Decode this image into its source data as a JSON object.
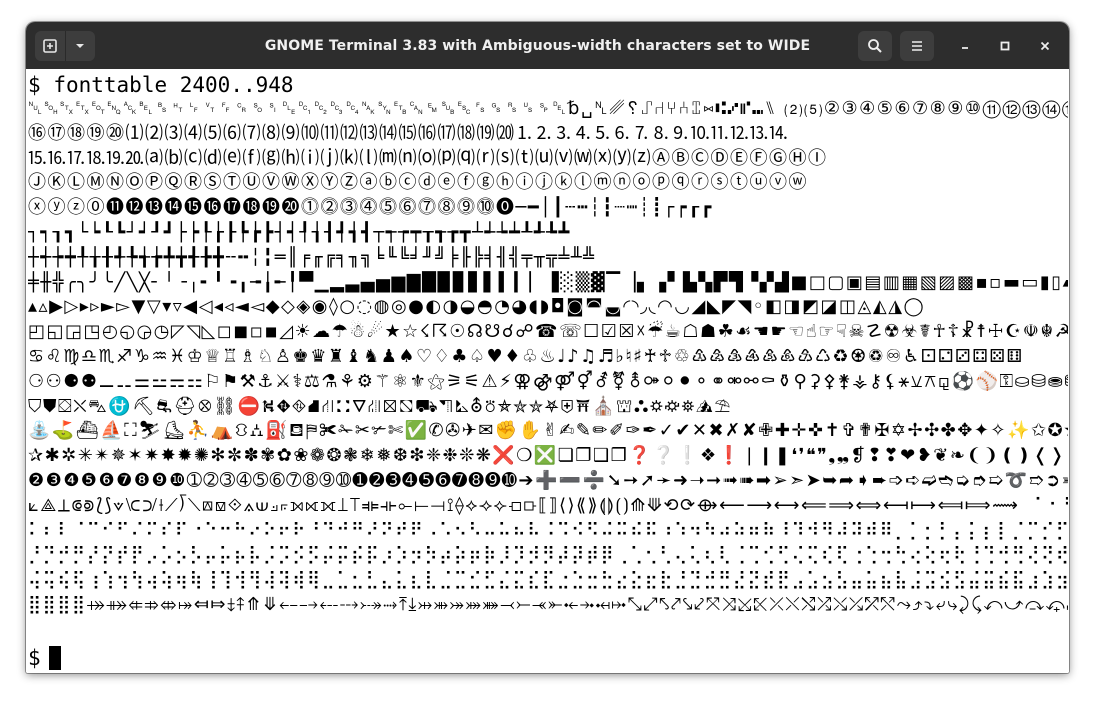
{
  "window": {
    "title": "GNOME Terminal 3.83 with Ambiguous-width characters set to WIDE"
  },
  "titlebar": {
    "new_tab_icon": "new-tab-icon",
    "menu_dropdown_icon": "chevron-down-icon",
    "search_icon": "search-icon",
    "hamburger_icon": "hamburger-menu-icon",
    "minimize_icon": "minimize-icon",
    "maximize_icon": "maximize-icon",
    "close_icon": "close-icon"
  },
  "terminal": {
    "prompt_symbol": "$",
    "command": "fonttable 2400..948",
    "rows": [
      "␀␁␂␃␄␅␆␇␈␉␊␋␌␍␎␏␐␑␒␓␔␕␖␗␘␙␚␛␜␝␞␟␠␡␢␣␤␥␦⑀⑁⑂⑃⑄⑅⑆⑇⑈⑉⑊ ⑵⑸②③④⑤⑥⑦⑧⑨⑩⑪⑫⑬⑭⑮",
      "⑯⑰⑱⑲⑳⑴⑵⑶⑷⑸⑹⑺⑻⑼⑽⑾⑿⒀⒁⒂⒃⒄⒅⒆⒇⒈⒉⒊⒋⒌⒍⒎⒏⒐⒑⒒⒓⒔⒕",
      "⒖⒗⒘⒙⒚⒛⒜⒝⒞⒟⒠⒡⒢⒣⒤⒥⒦⒧⒨⒩⒪⒫⒬⒭⒮⒯⒰⒱⒲⒳⒴⒵ⒶⒷⒸⒹⒺⒻⒼⒽⒾ",
      "ⒿⓀⓁⓂⓃⓄⓅⓆⓇⓈⓉⓊⓋⓌⓍⓎⓏⓐⓑⓒⓓⓔⓕⓖⓗⓘⓙⓚⓛⓜⓝⓞⓟⓠⓡⓢⓣⓤⓥⓦ",
      "ⓧⓨⓩ⓪⓫⓬⓭⓮⓯⓰⓱⓲⓳⓴⓵⓶⓷⓸⓹⓺⓻⓼⓽⓾⓿─━│┃┄┅┆┇┈┉┊┋┌┍┎┏",
      "┐┑┒┓└┕┖┗┘┙┚┛├┝┞┟┠┡┢┣┤┥┦┧┨┩┪┫┬┭┮┯┰┱┲┳┴┵┶┷┸┹┺┻",
      "┼┽┾┿╀╁╂╃╄╅╆╇╈╉╊╋╌╍╎╏═║╒╓╔╕╖╗╘╙╚╛╜╝╞╟╠╡╢╣╤╥╦╧╨╩",
      "╪╫╬╭╮╯╰╱╲╳╴╵╶╷╸╹╺╻╼╽╾╿▀▁▂▃▄▅▆▇█▉▊▋▌▍▎▏▐░▒▓▔▕▖▗▘▙▚▛▜▝▞▟■□▢▣▤▥▦▧▨▩▪▫▬▭▮▯▰▱▲△",
      "▴▵▶▷▸▹►▻▼▽▾▿◀◁◂◃◄◅◆◇◈◉◊○◌◍◎●◐◑◒◓◔◕◖◗◘◙◚◛◜◝◞◟◠◡◢◣◤◥◦◧◨◩◪◫◬◭◮◯",
      "◰◱◲◳◴◵◶◷◸◹◺◻◼◽◾◿☀☁☂☃☄★☆☇☈☉☊☋☌☍☎☏☐☑☒☓☔☕☖☗☘☙☚☛☜☝☞☟☠☡☢☣☤☥☦☧☨☩☪☫☬☭☮☯☰☱☲☳☴☵☶☷☸☹☺☻☼☽☾☿♀♁♂♃♄♅♆♇♈♉♊",
      "♋♌♍♎♏♐♑♒♓♔♕♖♗♘♙♚♛♜♝♞♟♠♡♢♣♤♥♦♧♨♩♪♫♬♭♮♯♰♱♲♳♴♵♶♷♸♹♺♻♼♽♾♿⚀⚁⚂⚃⚄⚅",
      "⚆⚇⚈⚉⚊⚋⚌⚍⚎⚏⚐⚑⚒⚓⚔⚕⚖⚗⚘⚙⚚⚛⚜⚝⚞⚟⚠⚡⚢⚣⚤⚥⚦⚧⚨⚩⚪⚫⚬⚭⚮⚯⚰⚱⚲⚳⚴⚵⚶⚷⚸⚹⚺⚻⚼⚽⚾⚿⛀⛁⛂⛃⛄⛅⛆⛇⛈",
      "⛉⛊⛋⛌⛍⛎⛏⛐⛑⛒⛓⛔⛕⛖⛗⛘⛙⛚⛛⛜⛝⛞⛟⛠⛡⛢⛣⛤⛥⛦⛧⛨⛩⛪⛫⛬⛭⛮⛯⛰⛱",
      "⛲⛳⛴⛵⛶⛷⛸⛹⛺⛻⛼⛽⛾⛿✀✁✂✃✄✅✆✇✈✉✊✋✌✍✎✏✐✑✒✓✔✕✖✗✘✙✚✛✜✝✞✟✠✡✢✣✤✥✦✧✨✩✪✫✬✭✮✯",
      "✰✱✲✳✴✵✶✷✸✹✺✻✼✽✾✿❀❁❂❃❄❅❆❇❈❉❊❋❌❍❎❏❐❑❒❓❔❕❖❗❘❙❚❛❜❝❞❟❠❡❢❣❤❥❦❧❨❩❪❫❬❭❮❯❰❱❲❳❴❵❶",
      "❷❸❹❺❻❼❽❾❿➀➁➂➃➄➅➆➇➈➉➊➋➌➍➎➏➐➑➒➓➔➕➖➗➘➙➚➛➜➝➞➟➠➡➢➣➤➥➦➧➨➩➪➫➬➭➮➯➰➱➲➳➴➵➶➷➸➹➺➻➼➽➾➿",
      "⟀⟁⟂⟃⟄⟅⟆⟇⟈⟉⟊⟋⟌⟍⟎⟏⟐⟑⟒⟓⟔⟕⟖⟗⟘⟙⟚⟛⟜⟝⟞⟟⟠⟡⟢⟣⟤⟥⟦⟧⟨⟩⟪⟫⟬⟭⟮⟯⟰⟱⟲⟳⟴⟵⟶⟷⟸⟹⟺⟻⟼⟽⟾⟿⠀⠁⠂⠃⠄",
      "⠅⠆⠇⠈⠉⠊⠋⠌⠍⠎⠏⠐⠑⠒⠓⠔⠕⠖⠗⠘⠙⠚⠛⠜⠝⠞⠟⠠⠡⠢⠣⠤⠥⠦⠧⠨⠩⠪⠫⠬⠭⠮⠯⠰⠱⠲⠳⠴⠵⠶⠷⠸⠹⠺⠻⠼⠽⠾⠿⡀⡁⡂⡃⡄⡅⡆⡇⡈⡉⡊⡋⡌⡍⡎⡏⡐⡑⡒⡓⡔⡕⡖⡗",
      "⡘⡙⡚⡛⡜⡝⡞⡟⡠⡡⡢⡣⡤⡥⡦⡧⡨⡩⡪⡫⡬⡭⡮⡯⡰⡱⡲⡳⡴⡵⡶⡷⡸⡹⡺⡻⡼⡽⡾⡿⢀⢁⢂⢃⢄⢅⢆⢇⢈⢉⢊⢋⢌⢍⢎⢏⢐⢑⢒⢓⢔⢕⢖⢗⢘⢙⢚⢛⢜⢝⢞⢟⢠⢡⢢⢣⢤⢥⢦⢧⢨⢩⢪⢫",
      "⢬⢭⢮⢯⢰⢱⢲⢳⢴⢵⢶⢷⢸⢹⢺⢻⢼⢽⢾⢿⣀⣁⣂⣃⣄⣅⣆⣇⣈⣉⣊⣋⣌⣍⣎⣏⣐⣑⣒⣓⣔⣕⣖⣗⣘⣙⣚⣛⣜⣝⣞⣟⣠⣡⣢⣣⣤⣥⣦⣧⣨⣩⣪⣫⣬⣭⣮⣯⣰⣱⣲⣳⣴⣵⣶⣷⣸⣹⣺⣻⣼⣽⣾⣿",
      "⣿⣿⣿⣿⤀⤁⤂⤃⤄⤅⤆⤇⤈⤉⤊⤋⤌⤍⤎⤏⤐⤑⤒⤓⤔⤕⤖⤗⤘⤙⤚⤛⤜⤝⤞⤟⤠⤡⤢⤣⤤⤥⤦⤧⤨⤩⤪⤫⤬⤭⤮⤯⤰⤱⤲⤳⤴⤵⤶⤷⤸⤹⤺⤻⤼⤽⤾⤿⥀⥁⥂⥃⥄⥅⥆⥇⥈⥉⥊⥋⥌⥍⥎⥏"
    ]
  }
}
